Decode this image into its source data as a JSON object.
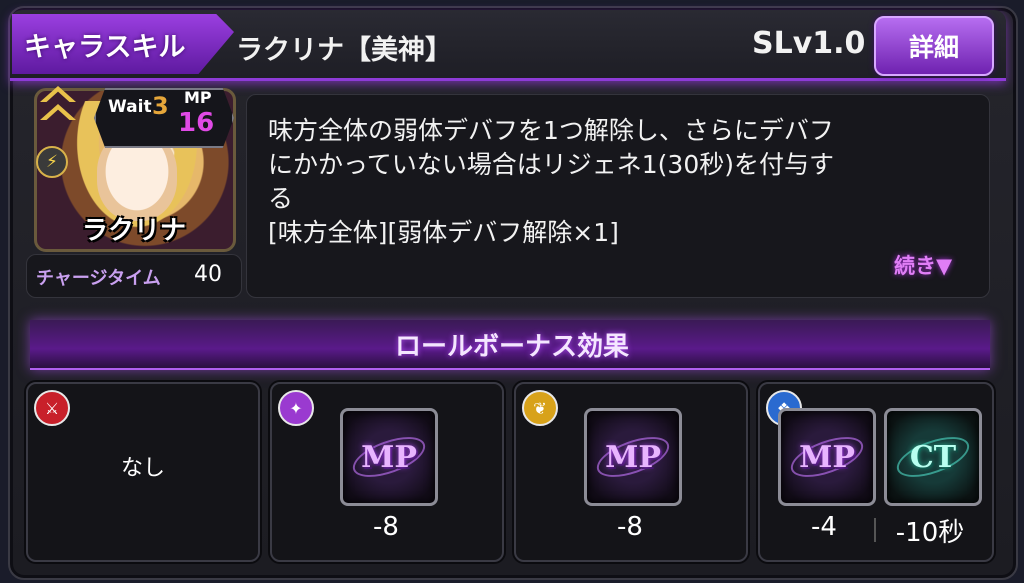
{
  "header": {
    "tab_label": "キャラスキル",
    "skill_name": "ラクリナ【美神】",
    "skill_level": "SLv1.0",
    "detail_button": "詳細"
  },
  "character": {
    "name": "ラクリナ",
    "wait_label": "Wait",
    "wait_value": "3",
    "mp_label": "MP",
    "mp_value": "16",
    "rank_icon": "double-chevron-icon",
    "element_icon": "lightning-icon",
    "charge_label": "チャージタイム",
    "charge_value": "40"
  },
  "description": {
    "text": "味方全体の弱体デバフを1つ解除し、さらにデバフ\nにかかっていない場合はリジェネ1(30秒)を付与す\nる\n[味方全体][弱体デバフ解除×1]",
    "more_label": "続き▼"
  },
  "role_bonus": {
    "title": "ロールボーナス効果",
    "cards": [
      {
        "role_icon": "sword-role-icon",
        "role_color": "#c8202a",
        "text": "なし"
      },
      {
        "role_icon": "staff-role-icon",
        "role_color": "#9a3ad0",
        "bonuses": [
          {
            "label": "MP",
            "value": "-8"
          }
        ]
      },
      {
        "role_icon": "wing-role-icon",
        "role_color": "#d8a21a",
        "bonuses": [
          {
            "label": "MP",
            "value": "-8"
          }
        ]
      },
      {
        "role_icon": "shield-role-icon",
        "role_color": "#2a6ad0",
        "bonuses": [
          {
            "label": "MP",
            "value": "-4"
          },
          {
            "label": "CT",
            "value": "-10秒"
          }
        ]
      }
    ]
  }
}
